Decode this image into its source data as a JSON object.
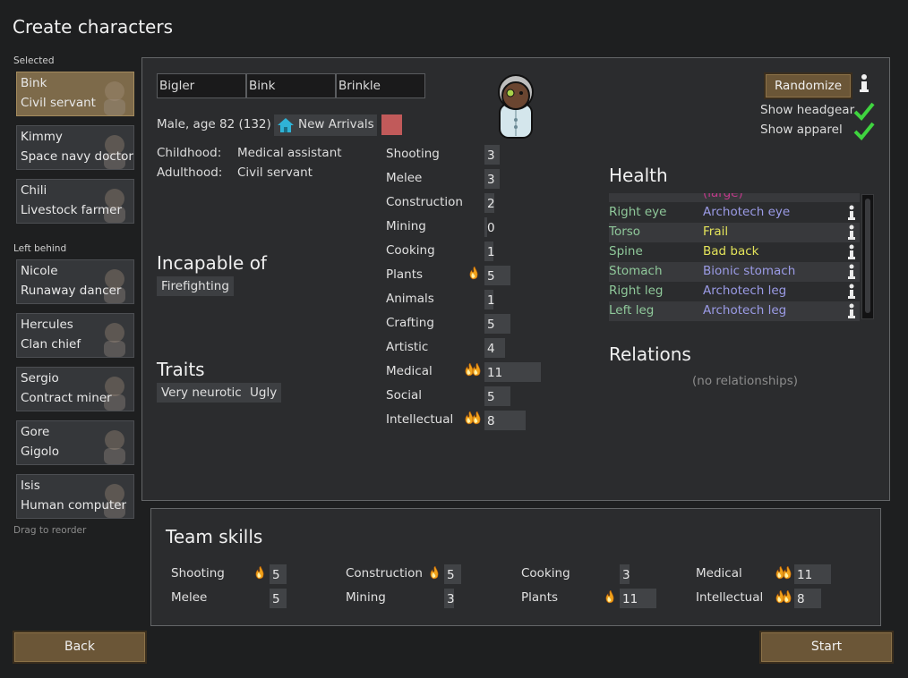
{
  "title": "Create characters",
  "selected_label": "Selected",
  "left_behind_label": "Left behind",
  "drag_hint": "Drag to reorder",
  "selected_pawns": [
    {
      "name": "Bink",
      "title": "Civil servant"
    },
    {
      "name": "Kimmy",
      "title": "Space navy doctor"
    },
    {
      "name": "Chili",
      "title": "Livestock farmer"
    }
  ],
  "left_behind_pawns": [
    {
      "name": "Nicole",
      "title": "Runaway dancer"
    },
    {
      "name": "Hercules",
      "title": "Clan chief"
    },
    {
      "name": "Sergio",
      "title": "Contract miner"
    },
    {
      "name": "Gore",
      "title": "Gigolo"
    },
    {
      "name": "Isis",
      "title": "Human computer"
    }
  ],
  "character": {
    "first_name": "Bigler",
    "nick_name": "Bink",
    "last_name": "Brinkle",
    "summary": "Male, age 82 (132)",
    "faction": "New Arrivals",
    "faction_color": "#c15a5a",
    "childhood_label": "Childhood:",
    "childhood": "Medical assistant",
    "adulthood_label": "Adulthood:",
    "adulthood": "Civil servant",
    "incapable_header": "Incapable of",
    "incapable": [
      "Firefighting"
    ],
    "traits_header": "Traits",
    "traits": [
      "Very neurotic",
      "Ugly"
    ]
  },
  "skills": [
    {
      "name": "Shooting",
      "value": "3",
      "passion": 0
    },
    {
      "name": "Melee",
      "value": "3",
      "passion": 0
    },
    {
      "name": "Construction",
      "value": "2",
      "passion": 0
    },
    {
      "name": "Mining",
      "value": "0",
      "passion": 0
    },
    {
      "name": "Cooking",
      "value": "1",
      "passion": 0
    },
    {
      "name": "Plants",
      "value": "5",
      "passion": 1
    },
    {
      "name": "Animals",
      "value": "1",
      "passion": 0
    },
    {
      "name": "Crafting",
      "value": "5",
      "passion": 0
    },
    {
      "name": "Artistic",
      "value": "4",
      "passion": 0
    },
    {
      "name": "Medical",
      "value": "11",
      "passion": 2
    },
    {
      "name": "Social",
      "value": "5",
      "passion": 0
    },
    {
      "name": "Intellectual",
      "value": "8",
      "passion": 2
    }
  ],
  "randomize_label": "Randomize",
  "show_headgear_label": "Show headgear",
  "show_apparel_label": "Show apparel",
  "health_header": "Health",
  "health_partial": "(large)",
  "health": [
    {
      "part": "Right eye",
      "condition": "Archotech eye",
      "color": "#9b9be6"
    },
    {
      "part": "Torso",
      "condition": "Frail",
      "color": "#e3e35a"
    },
    {
      "part": "Spine",
      "condition": "Bad back",
      "color": "#e3e35a"
    },
    {
      "part": "Stomach",
      "condition": "Bionic stomach",
      "color": "#9b9be6"
    },
    {
      "part": "Right leg",
      "condition": "Archotech leg",
      "color": "#9b9be6"
    },
    {
      "part": "Left leg",
      "condition": "Archotech leg",
      "color": "#9b9be6"
    }
  ],
  "relations_header": "Relations",
  "no_relationships": "(no relationships)",
  "team_skills_header": "Team skills",
  "team_skills": [
    {
      "name": "Shooting",
      "value": "5",
      "passion": 1
    },
    {
      "name": "Melee",
      "value": "5",
      "passion": 0
    },
    {
      "name": "Construction",
      "value": "5",
      "passion": 1
    },
    {
      "name": "Mining",
      "value": "3",
      "passion": 0
    },
    {
      "name": "Cooking",
      "value": "3",
      "passion": 0
    },
    {
      "name": "Plants",
      "value": "11",
      "passion": 1
    },
    {
      "name": "Medical",
      "value": "11",
      "passion": 2
    },
    {
      "name": "Intellectual",
      "value": "8",
      "passion": 2
    }
  ],
  "back_label": "Back",
  "start_label": "Start"
}
